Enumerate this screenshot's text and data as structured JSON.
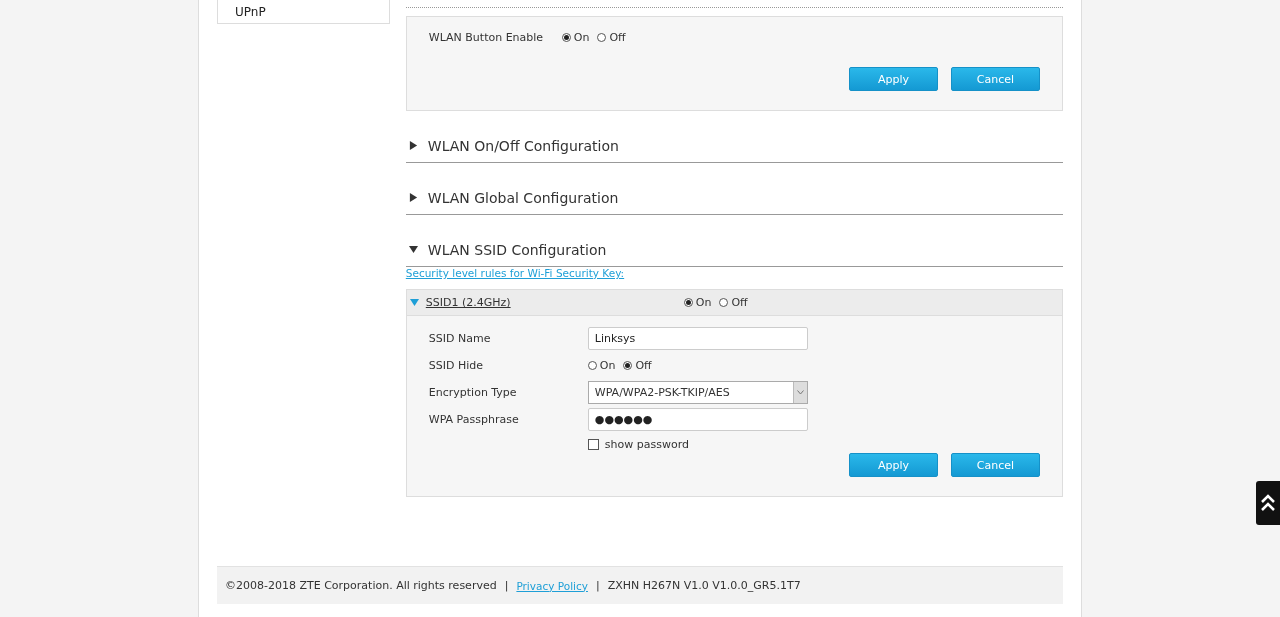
{
  "sidebar": {
    "items": [
      {
        "label": "UPnP",
        "selected": false
      }
    ]
  },
  "wlan_button": {
    "label": "WLAN Button Enable",
    "options": [
      {
        "label": "On",
        "selected": true
      },
      {
        "label": "Off",
        "selected": false
      }
    ],
    "buttons": [
      "Apply",
      "Cancel"
    ]
  },
  "sections": [
    {
      "title": "WLAN On/Off Configuration",
      "expanded": false
    },
    {
      "title": "WLAN Global Configuration",
      "expanded": false
    },
    {
      "title": "WLAN SSID Configuration",
      "expanded": true
    }
  ],
  "security_link": "Security level rules for Wi-Fi Security Key:",
  "ssid": {
    "title": "SSID1 (2.4GHz)",
    "expanded": true,
    "options": [
      {
        "label": "On",
        "selected": true
      },
      {
        "label": "Off",
        "selected": false
      }
    ],
    "fields": [
      {
        "kind": "text",
        "label": "SSID Name",
        "value": "Linksys"
      },
      {
        "kind": "radio",
        "label": "SSID Hide",
        "options": [
          {
            "label": "On",
            "selected": false
          },
          {
            "label": "Off",
            "selected": true
          }
        ]
      },
      {
        "kind": "select",
        "label": "Encryption Type",
        "value": "WPA/WPA2-PSK-TKIP/AES"
      },
      {
        "kind": "password",
        "label": "WPA Passphrase",
        "value": "●●●●●●"
      }
    ],
    "show_password": {
      "label": "show password",
      "checked": false
    },
    "buttons": [
      "Apply",
      "Cancel"
    ]
  },
  "footer": {
    "copyright": "©2008-2018 ZTE Corporation. All rights reserved",
    "separator_1": "|",
    "privacy": "Privacy Policy",
    "separator_2": "|",
    "version": "ZXHN H267N V1.0 V1.0.0_GR5.1T7"
  }
}
